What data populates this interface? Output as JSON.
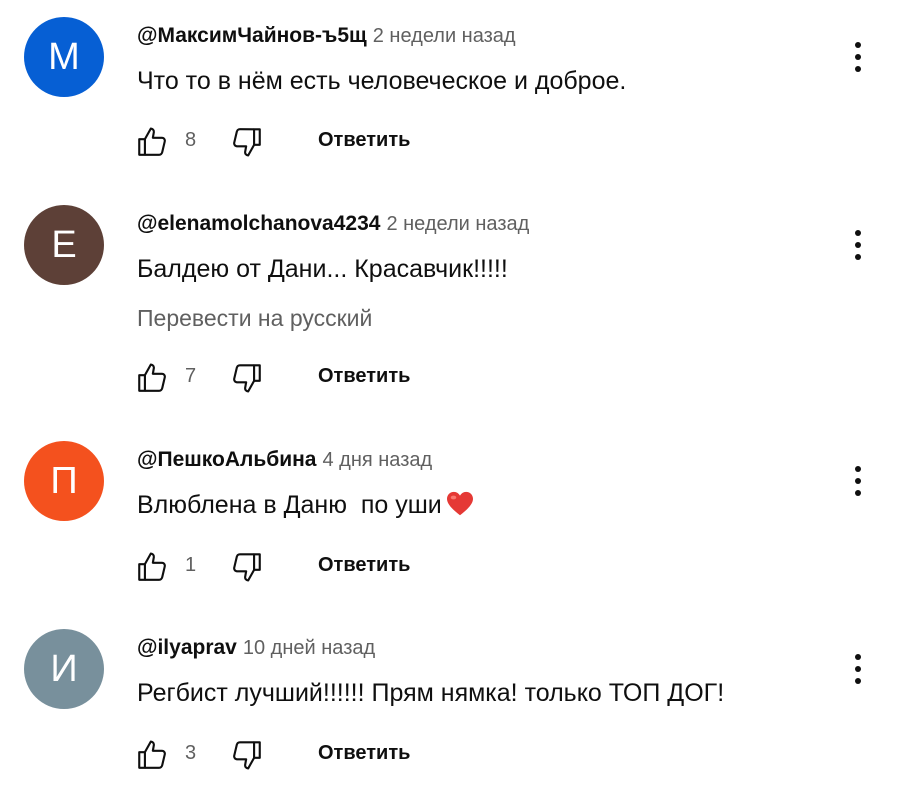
{
  "comments": [
    {
      "author": "@МаксимЧайнов-ъ5щ",
      "time": "2 недели назад",
      "avatar_letter": "М",
      "avatar_color": "#065fd4",
      "text": "Что то в нём есть человеческое и доброе.",
      "likes": "8",
      "reply_label": "Ответить"
    },
    {
      "author": "@elenamolchanova4234",
      "time": "2 недели назад",
      "avatar_letter": "E",
      "avatar_color": "#5d4037",
      "text": "Балдею от Дани... Красавчик!!!!!",
      "translate_label": "Перевести на русский",
      "likes": "7",
      "reply_label": "Ответить"
    },
    {
      "author": "@ПешкоАльбина",
      "time": "4 дня назад",
      "avatar_letter": "П",
      "avatar_color": "#f4511e",
      "text": "Влюблена в Даню  по уши",
      "emoji": "red-heart-emoji",
      "likes": "1",
      "reply_label": "Ответить"
    },
    {
      "author": "@ilyaprav",
      "time": "10 дней назад",
      "avatar_letter": "И",
      "avatar_color": "#78909c",
      "text": "Регбист лучший!!!!!! Прям нямка! только ТОП ДОГ!",
      "likes": "3",
      "reply_label": "Ответить"
    }
  ],
  "icons": {
    "like": "thumbs-up-icon",
    "dislike": "thumbs-down-icon",
    "menu": "more-vertical-icon"
  }
}
